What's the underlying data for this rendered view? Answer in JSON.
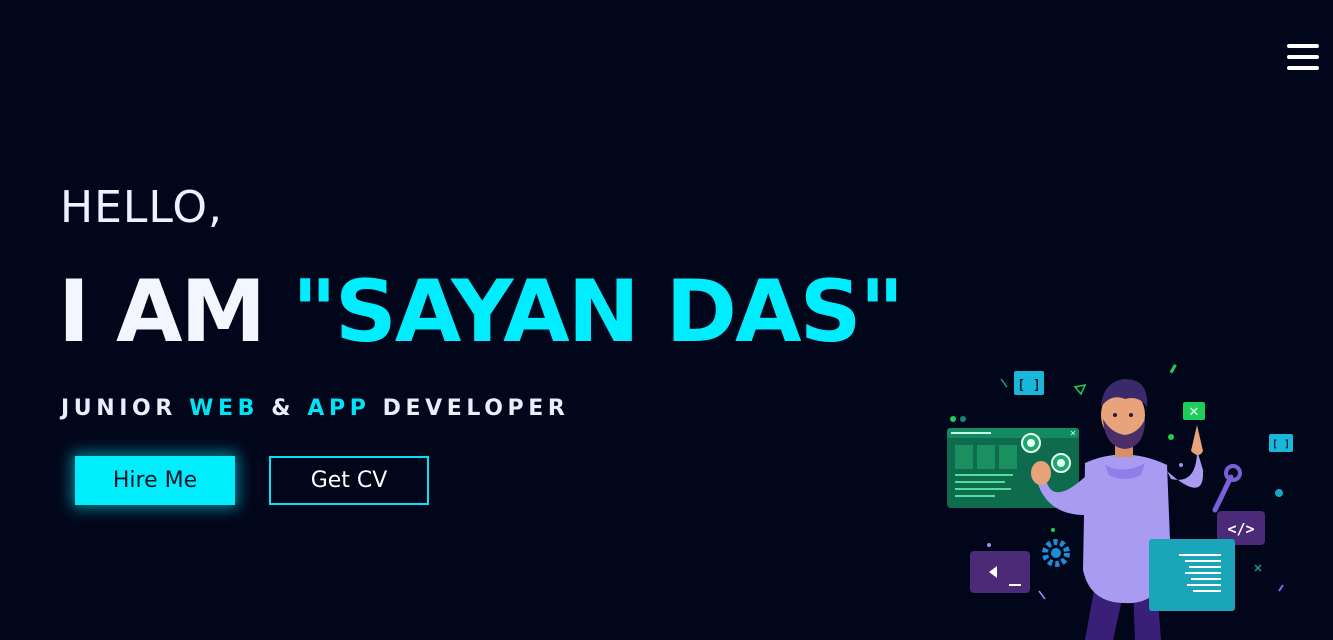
{
  "nav": {
    "menu_icon": "hamburger-menu-icon"
  },
  "hero": {
    "greeting": "HELLO,",
    "intro": "I AM ",
    "name": "\"SAYAN DAS\"",
    "role": {
      "prefix": "JUNIOR ",
      "web": "WEB",
      "amp": " & ",
      "app": "APP",
      "suffix": " DEVELOPER"
    }
  },
  "buttons": {
    "hire": "Hire Me",
    "cv": "Get CV"
  },
  "colors": {
    "background": "#02061a",
    "accent": "#00ecff",
    "text": "#f3f5ff"
  },
  "illustration": {
    "icon": "developer-illustration",
    "bracket_text": "[ ]",
    "code_text": "</>"
  }
}
